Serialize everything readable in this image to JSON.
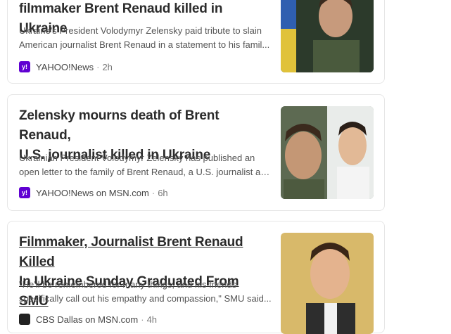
{
  "articles": [
    {
      "headline_lines": [
        "filmmaker Brent Renaud killed in Ukraine"
      ],
      "snippet_lines": [
        "Ukraine's President Volodymyr Zelensky paid tribute to slain",
        "American journalist Brent Renaud in a statement to his famil..."
      ],
      "source": "YAHOO!News",
      "time": "2h",
      "logo_text": "y!",
      "logo_color": "#6001d2"
    },
    {
      "headline_lines": [
        "Zelensky mourns death of Brent Renaud,",
        "U.S. journalist killed in Ukraine"
      ],
      "snippet_lines": [
        "Ukrainian President Volodymyr Zelensky has published an",
        "open letter to the family of Brent Renaud, a U.S. journalist an..."
      ],
      "source": "YAHOO!News on MSN.com",
      "time": "6h",
      "logo_text": "y!",
      "logo_color": "#6001d2"
    },
    {
      "headline_lines": [
        "Filmmaker, Journalist Brent Renaud Killed",
        "In Ukraine Sunday Graduated From SMU"
      ],
      "snippet_lines": [
        "\"He'll be remembered for many things, and his friends",
        "specifically call out his empathy and compassion,\" SMU said..."
      ],
      "source": "CBS Dallas on MSN.com",
      "time": "4h",
      "logo_text": "",
      "logo_color": "#222222"
    }
  ],
  "separator": "·"
}
